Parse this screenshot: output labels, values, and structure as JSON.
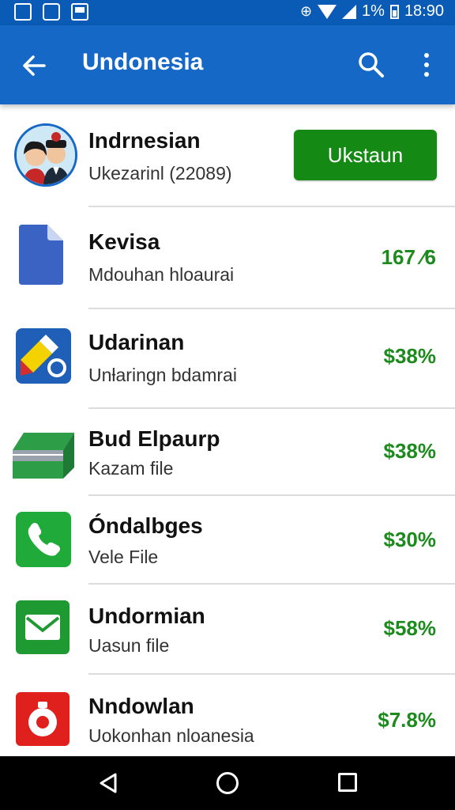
{
  "status_bar": {
    "battery": "1%",
    "time": "18:90"
  },
  "app_bar": {
    "title": "Undonesia"
  },
  "header_item": {
    "name": "Indrnesian",
    "subtitle": "Ukezarinl (22089)",
    "button_label": "Ukstaun"
  },
  "items": [
    {
      "name": "Kevisa",
      "subtitle": "Mdouhan hloaurai",
      "value": "167 ⁄6",
      "icon": "document-icon"
    },
    {
      "name": "Udarinan",
      "subtitle": "Unƚaringn bdamrai",
      "value": "$38%",
      "icon": "pencil-app-icon"
    },
    {
      "name": "Bud Elpaurp",
      "subtitle": "Kazam file",
      "value": "$38%",
      "icon": "file-stack-icon"
    },
    {
      "name": "Óndalbges",
      "subtitle": "Vele File",
      "value": "$30%",
      "icon": "phone-icon"
    },
    {
      "name": "Undormian",
      "subtitle": "Uasun file",
      "value": "$58%",
      "icon": "mail-icon"
    },
    {
      "name": "Nndowlan",
      "subtitle": "Uokonhan nloanesia",
      "value": "$7.8%",
      "icon": "timer-icon"
    }
  ],
  "colors": {
    "app_bar": "#1668c7",
    "status_bar": "#0a5bb5",
    "accent_green": "#148a14",
    "value_green": "#1d8a1d"
  }
}
